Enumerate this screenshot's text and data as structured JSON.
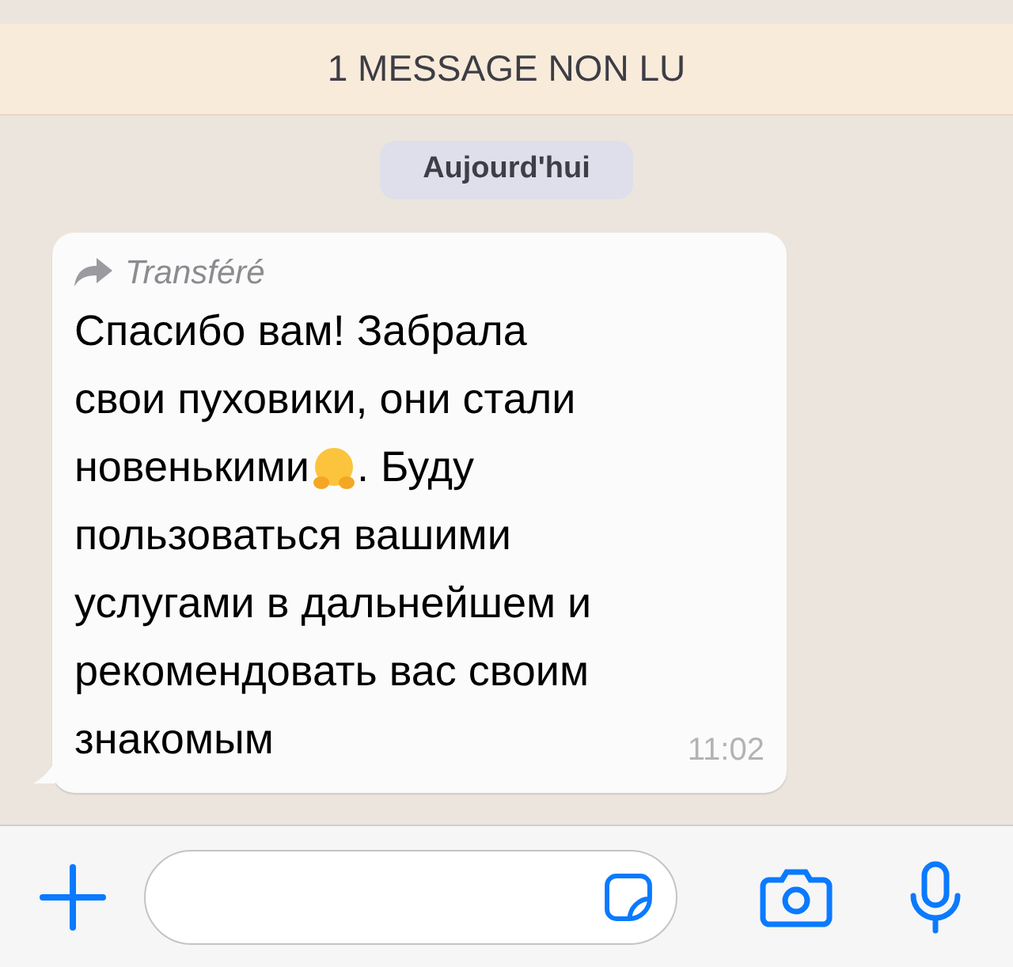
{
  "unread_banner": "1 MESSAGE NON LU",
  "date_chip": "Aujourd'hui",
  "message": {
    "forwarded": true,
    "forwarded_label": "Transféré",
    "lines": [
      {
        "text": "Спасибо вам! Забрала"
      },
      {
        "text": "свои пуховики, они стали"
      },
      {
        "text": "новенькими",
        "emoji": true,
        "text_after": ". Буду"
      },
      {
        "text": "пользоваться вашими"
      },
      {
        "text": "услугами в дальнейшем и"
      },
      {
        "text": "рекомендовать вас своим"
      },
      {
        "text": "знакомым"
      }
    ],
    "time": "11:02"
  }
}
